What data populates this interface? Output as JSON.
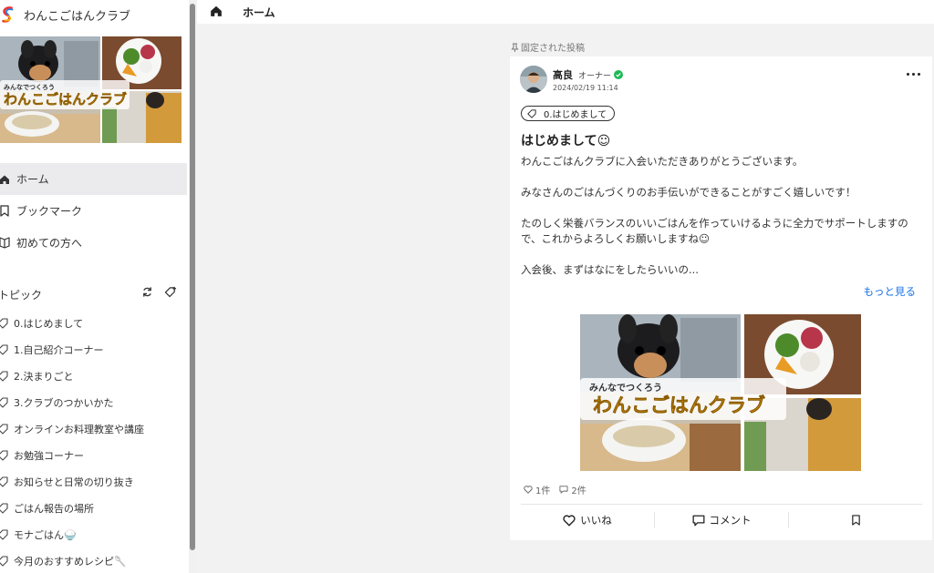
{
  "sidebar": {
    "brand_name": "わんこごはんクラブ",
    "banner": {
      "small_text": "みんなでつくろう",
      "big_text": "わんこごはんクラブ"
    },
    "nav": [
      {
        "label": "ホーム",
        "icon": "home-icon"
      },
      {
        "label": "ブックマーク",
        "icon": "bookmark-icon"
      },
      {
        "label": "初めての方へ",
        "icon": "beginner-icon"
      }
    ],
    "topics_heading": "トピック",
    "topics": [
      {
        "label": "0.はじめまして"
      },
      {
        "label": "1.自己紹介コーナー"
      },
      {
        "label": "2.決まりごと"
      },
      {
        "label": "3.クラブのつかいかた"
      },
      {
        "label": "オンラインお料理教室や講座"
      },
      {
        "label": "お勉強コーナー"
      },
      {
        "label": "お知らせと日常の切り抜き"
      },
      {
        "label": "ごはん報告の場所"
      },
      {
        "label": "モナごはん🍚"
      },
      {
        "label": "今月のおすすめレシピ🥄"
      }
    ]
  },
  "topbar": {
    "title": "ホーム"
  },
  "pinned_label": "固定された投稿",
  "post": {
    "author": "高良",
    "role": "オーナー",
    "date": "2024/02/19 11:14",
    "tag": "0.はじめまして",
    "title": "はじめまして☺",
    "paragraphs": [
      "わんこごはんクラブに入会いただきありがとうございます。",
      "みなさんのごはんづくりのお手伝いができることがすごく嬉しいです！",
      "たのしく栄養バランスのいいごはんを作っていけるように全力でサポートしますので、これからよろしくお願いしますね☺",
      "入会後、まずはなにをしたらいいの..."
    ],
    "see_more": "もっと見る",
    "image": {
      "small_text": "みんなでつくろう",
      "big_text": "わんこごはんクラブ"
    },
    "likes": "1件",
    "comments": "2件",
    "like_label": "いいね",
    "comment_label": "コメント"
  },
  "colors": {
    "accent_link": "#1a73e8",
    "verified": "#1db954",
    "banner_text": "#e8a317"
  }
}
